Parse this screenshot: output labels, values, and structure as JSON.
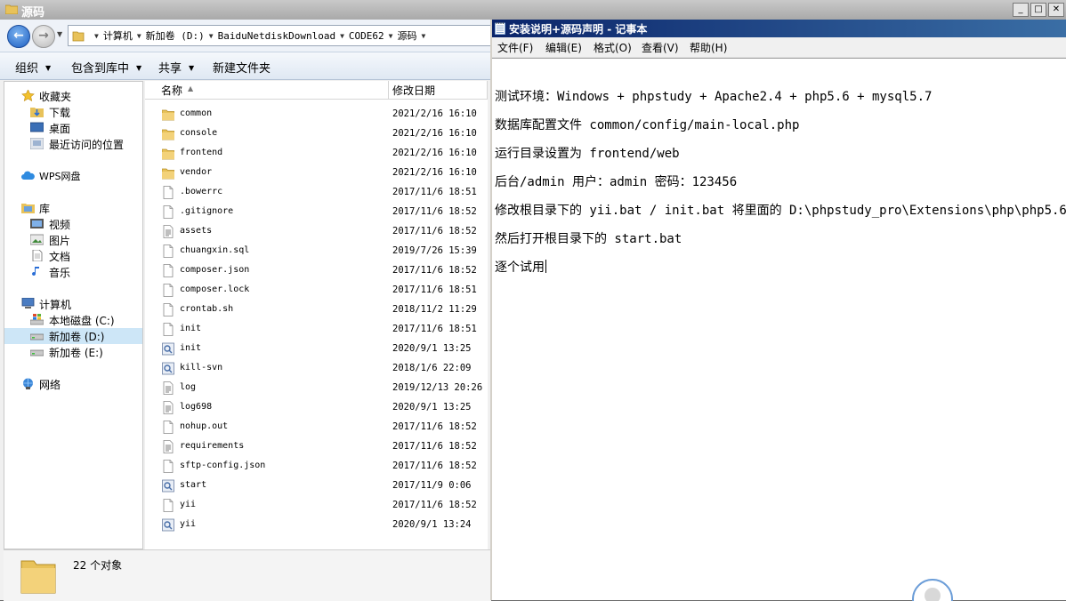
{
  "explorer": {
    "title": "源码",
    "breadcrumb": [
      "计算机",
      "新加卷 (D:)",
      "BaiduNetdiskDownload",
      "CODE62",
      "源码"
    ],
    "toolbar": [
      "组织",
      "包含到库中",
      "共享",
      "新建文件夹"
    ],
    "nav": {
      "favorites": "收藏夹",
      "downloads": "下载",
      "desktop": "桌面",
      "recent": "最近访问的位置",
      "wps": "WPS网盘",
      "libraries": "库",
      "videos": "视频",
      "pictures": "图片",
      "documents": "文档",
      "music": "音乐",
      "computer": "计算机",
      "local_c": "本地磁盘 (C:)",
      "vol_d": "新加卷 (D:)",
      "vol_e": "新加卷 (E:)",
      "network": "网络"
    },
    "columns": {
      "name": "名称",
      "modified": "修改日期"
    },
    "files": [
      {
        "name": "common",
        "date": "2021/2/16 16:10",
        "icon": "folder-icon"
      },
      {
        "name": "console",
        "date": "2021/2/16 16:10",
        "icon": "folder-icon"
      },
      {
        "name": "frontend",
        "date": "2021/2/16 16:10",
        "icon": "folder-icon"
      },
      {
        "name": "vendor",
        "date": "2021/2/16 16:10",
        "icon": "folder-icon"
      },
      {
        "name": ".bowerrc",
        "date": "2017/11/6 18:51",
        "icon": "file-icon"
      },
      {
        "name": ".gitignore",
        "date": "2017/11/6 18:52",
        "icon": "file-icon"
      },
      {
        "name": "assets",
        "date": "2017/11/6 18:52",
        "icon": "text-file-icon"
      },
      {
        "name": "chuangxin.sql",
        "date": "2019/7/26 15:39",
        "icon": "file-icon"
      },
      {
        "name": "composer.json",
        "date": "2017/11/6 18:52",
        "icon": "file-icon"
      },
      {
        "name": "composer.lock",
        "date": "2017/11/6 18:51",
        "icon": "file-icon"
      },
      {
        "name": "crontab.sh",
        "date": "2018/11/2 11:29",
        "icon": "file-icon"
      },
      {
        "name": "init",
        "date": "2017/11/6 18:51",
        "icon": "file-icon"
      },
      {
        "name": "init",
        "date": "2020/9/1 13:25",
        "icon": "batch-file-icon"
      },
      {
        "name": "kill-svn",
        "date": "2018/1/6 22:09",
        "icon": "batch-file-icon"
      },
      {
        "name": "log",
        "date": "2019/12/13 20:26",
        "icon": "text-file-icon"
      },
      {
        "name": "log698",
        "date": "2020/9/1 13:25",
        "icon": "text-file-icon"
      },
      {
        "name": "nohup.out",
        "date": "2017/11/6 18:52",
        "icon": "file-icon"
      },
      {
        "name": "requirements",
        "date": "2017/11/6 18:52",
        "icon": "text-file-icon"
      },
      {
        "name": "sftp-config.json",
        "date": "2017/11/6 18:52",
        "icon": "file-icon"
      },
      {
        "name": "start",
        "date": "2017/11/9 0:06",
        "icon": "batch-file-icon"
      },
      {
        "name": "yii",
        "date": "2017/11/6 18:52",
        "icon": "file-icon"
      },
      {
        "name": "yii",
        "date": "2020/9/1 13:24",
        "icon": "batch-file-icon"
      }
    ],
    "status": "22 个对象"
  },
  "notepad": {
    "title": "安装说明+源码声明 - 记事本",
    "menu": [
      "文件(F)",
      "编辑(E)",
      "格式(O)",
      "查看(V)",
      "帮助(H)"
    ],
    "lines": [
      "测试环境：Windows + phpstudy + Apache2.4 + php5.6 + mysql5.7",
      "数据库配置文件 common/config/main-local.php",
      "运行目录设置为 frontend/web",
      "后台/admin   用户：admin   密码：123456",
      "修改根目录下的 yii.bat / init.bat 将里面的 D:\\phpstudy_pro\\Extensions\\php\\php5.6.",
      "然后打开根目录下的 start.bat",
      "逐个试用"
    ]
  },
  "colors": {
    "folder": "#e8c25a",
    "selection": "#cde6f7",
    "notepad_title": "#0a246a"
  }
}
